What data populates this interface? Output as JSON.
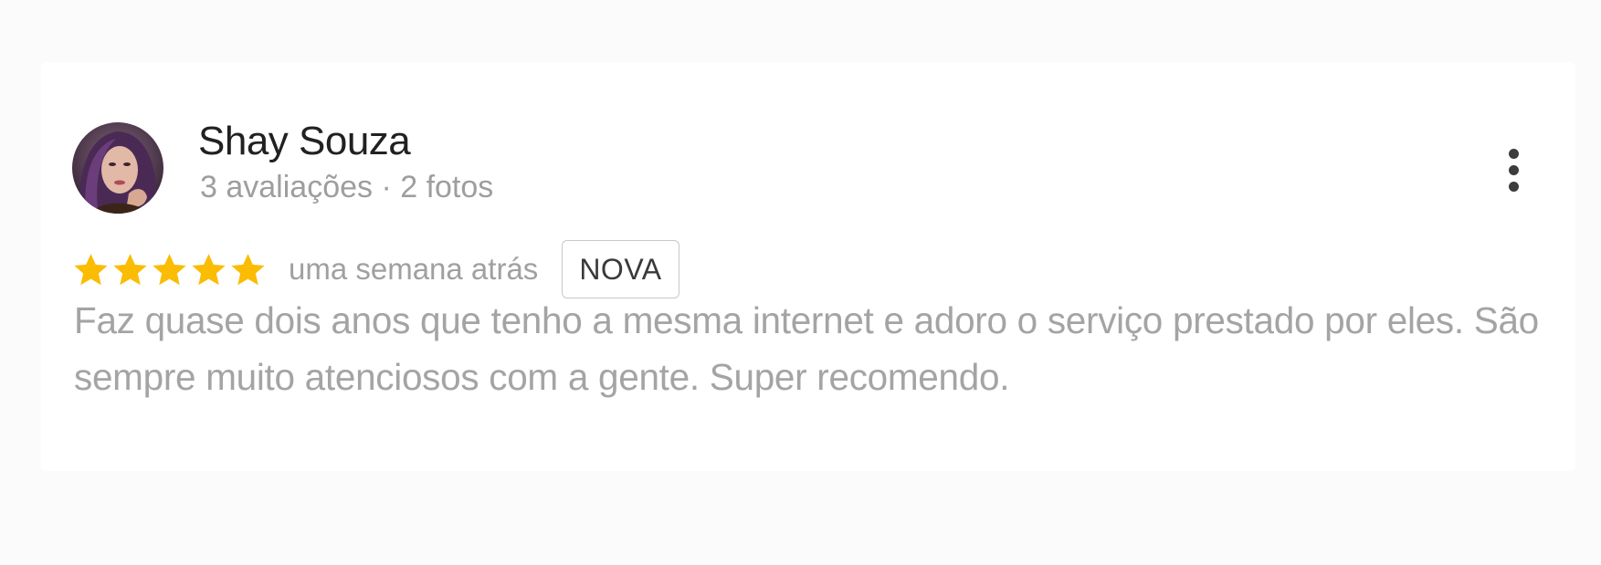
{
  "review": {
    "author": {
      "name": "Shay Souza",
      "meta": "3 avaliações · 2 fotos",
      "avatar_icon": "profile-photo-avatar"
    },
    "rating": {
      "stars": 5,
      "max_stars": 5,
      "star_color": "#fbbc04"
    },
    "date": "uma semana atrás",
    "badge": "NOVA",
    "text": "Faz quase dois anos que tenho a mesma internet e adoro o serviço prestado por eles. São sempre muito atenciosos com a gente. Super recomendo.",
    "more_icon": "more-vert-icon"
  }
}
